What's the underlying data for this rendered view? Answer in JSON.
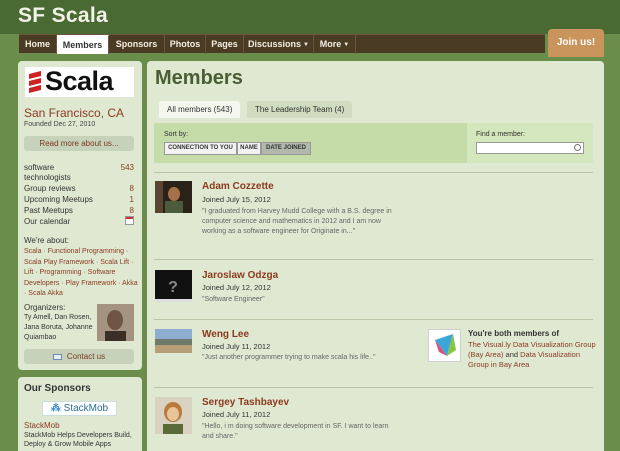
{
  "header": {
    "site_title": "SF Scala",
    "join_label": "Join us!"
  },
  "nav": {
    "home": "Home",
    "members": "Members",
    "sponsors": "Sponsors",
    "photos": "Photos",
    "pages": "Pages",
    "discussions": "Discussions",
    "more": "More"
  },
  "sidebar": {
    "logo_text": "Scala",
    "city": "San Francisco, CA",
    "founded": "Founded Dec 27, 2010",
    "read_more": "Read more about us...",
    "stats": [
      {
        "label": "software technologists",
        "value": "543"
      },
      {
        "label": "Group reviews",
        "value": "8"
      },
      {
        "label": "Upcoming Meetups",
        "value": "1"
      },
      {
        "label": "Past Meetups",
        "value": "8"
      },
      {
        "label": "Our calendar",
        "value": ""
      }
    ],
    "about_head": "We're about:",
    "about_text": "Scala · Functional Programming · Scala Play Framework · Scala Lift · Lift · Programming · Software Developers · Play Framework · Akka · Scala Akka",
    "organizers_head": "Organizers:",
    "organizers": "Ty Amell, Dan Rosen, Jana Boruta, Johanne Quiambao",
    "contact": "Contact us"
  },
  "sponsors": {
    "heading": "Our Sponsors",
    "logo_text": "StackMob",
    "name": "StackMob",
    "description": "StackMob Helps Developers Build, Deploy & Grow Mobile Apps"
  },
  "main": {
    "title": "Members",
    "tabs": [
      "All members (543)",
      "The Leadership Team (4)"
    ],
    "sort_label": "Sort by:",
    "sort_options": [
      "CONNECTION TO YOU",
      "NAME",
      "DATE JOINED"
    ],
    "find_label": "Find a member:",
    "find_value": ""
  },
  "members": [
    {
      "name": "Adam Cozzette",
      "joined": "Joined July 15, 2012",
      "quote": "\"I graduated from Harvey Mudd College with a B.S. degree in computer science and mathematics in 2012 and I am now working as a software engineer for Originate in...\""
    },
    {
      "name": "Jaroslaw Odzga",
      "joined": "Joined July 12, 2012",
      "quote": "\"Software Engineer\""
    },
    {
      "name": "Weng Lee",
      "joined": "Joined July 11, 2012",
      "quote": "\"Just another programmer trying to make scala his life..\""
    },
    {
      "name": "Sergey Tashbayev",
      "joined": "Joined July 11, 2012",
      "quote": "\"Hello, i m doing software development in SF. I want to learn and share.\""
    }
  ],
  "shared_groups": {
    "title": "You're both members of",
    "prefix": "",
    "group1": "The Visual.ly Data Visualization Group (Bay Area)",
    "and": " and ",
    "group2": "Data Visualization Group in Bay Area"
  },
  "colors": {
    "header_bg": "#4a6a33",
    "page_bg": "#6b8d4b",
    "nav_bg": "#4a3b25",
    "join_bg": "#c9955d",
    "link": "#8b3a1e",
    "panel_bg": "#dfe9d2"
  },
  "icons": [
    "scala-logo-icon",
    "calendar-icon",
    "envelope-icon",
    "magnifier-icon",
    "visually-logo-icon"
  ]
}
